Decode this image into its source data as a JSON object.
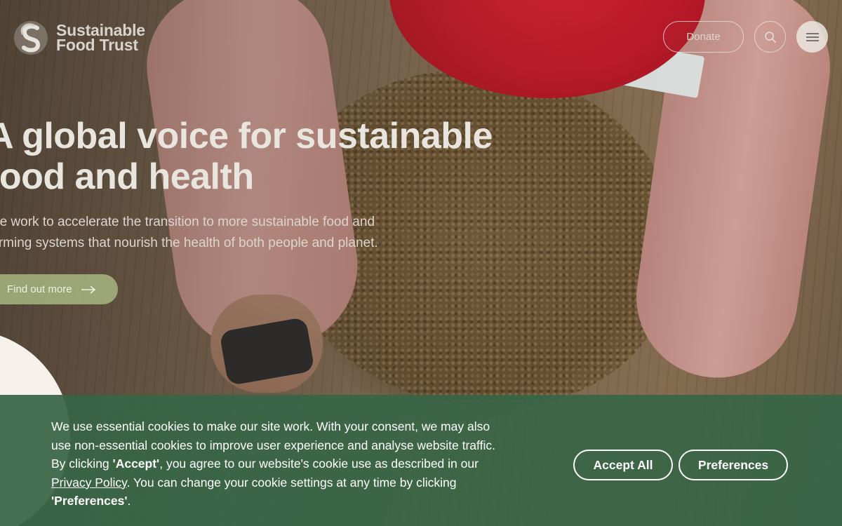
{
  "header": {
    "logo_line1": "Sustainable",
    "logo_line2": "Food Trust",
    "donate_label": "Donate",
    "search_icon": "search-icon",
    "menu_icon": "hamburger-menu-icon"
  },
  "hero": {
    "title": "A global voice for sustainable food and health",
    "subtitle": "We work to accelerate the transition to more sustainable food and farming systems that nourish the health of both people and planet.",
    "cta_label": "Find out more",
    "cta_icon": "arrow-right-icon"
  },
  "cookie_banner": {
    "text_part1": "We use essential cookies to make our site work. With your consent, we may also use non-essential cookies to improve user experience and analyse website traffic. By clicking ",
    "accept_quote": "'Accept'",
    "text_part2": ", you agree to our website's cookie use as described in our ",
    "privacy_link": "Privacy Policy",
    "text_part3": ". You can change your cookie settings at any time by clicking ",
    "preferences_quote": "'Preferences'",
    "text_part4": ".",
    "accept_all_label": "Accept All",
    "preferences_label": "Preferences"
  },
  "colors": {
    "banner_green": "#386546",
    "cta_green": "#aab982",
    "bowl_red": "#c8182a"
  }
}
